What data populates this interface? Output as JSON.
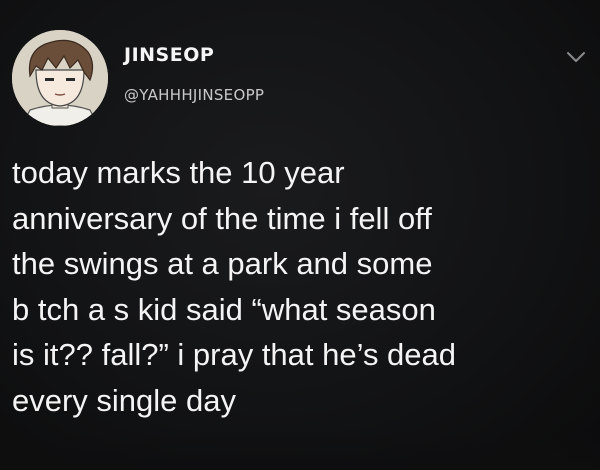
{
  "tweet": {
    "author": {
      "display_name": "JINSEOP",
      "handle": "@YAHHHJINSEOPP",
      "avatar_icon": "anime-boy-avatar"
    },
    "menu_icon": "chevron-down-icon",
    "text_lines": [
      "today marks the 10 year",
      "anniversary of the time i fell off",
      "the swings at a park and some",
      "b tch a s kid said “what season",
      "is it?? fall?” i pray that he’s dead",
      "every single day"
    ]
  },
  "colors": {
    "background": "#121314",
    "text": "#f4f4f4",
    "handle": "#c9c9c9",
    "chevron": "#8a8a8a"
  }
}
